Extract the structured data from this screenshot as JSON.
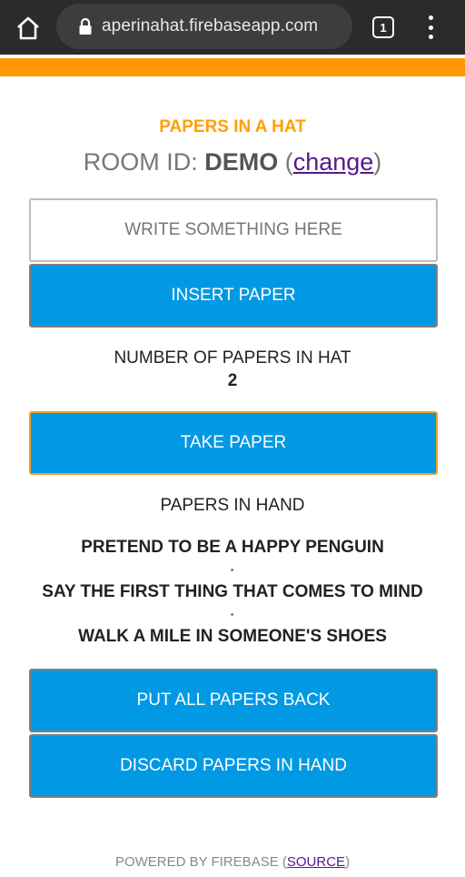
{
  "browser": {
    "url": "aperinahat.firebaseapp.com",
    "tab_count": "1",
    "home_icon": "home-icon",
    "lock_icon": "lock-icon",
    "menu_icon": "more-vert-icon"
  },
  "colors": {
    "accent": "#ff9800",
    "button": "#0199e4",
    "title": "#ff9f00",
    "link": "#551a8b"
  },
  "app": {
    "title": "PAPERS IN A HAT",
    "room_prefix": "ROOM ID: ",
    "room_id": "DEMO",
    "change_open": " (",
    "change_label": "change",
    "change_close": ")",
    "input_placeholder": "WRITE SOMETHING HERE",
    "insert_label": "INSERT PAPER",
    "count_label": "NUMBER OF PAPERS IN HAT",
    "count_value": "2",
    "take_label": "TAKE PAPER",
    "hand_label": "PAPERS IN HAND",
    "hand_items": [
      "PRETEND TO BE A HAPPY PENGUIN",
      "SAY THE FIRST THING THAT COMES TO MIND",
      "WALK A MILE IN SOMEONE'S SHOES"
    ],
    "separator": "·",
    "put_back_label": "PUT ALL PAPERS BACK",
    "discard_label": "DISCARD PAPERS IN HAND"
  },
  "footer": {
    "text": "POWERED BY FIREBASE (",
    "source_label": "SOURCE",
    "close": ")"
  }
}
